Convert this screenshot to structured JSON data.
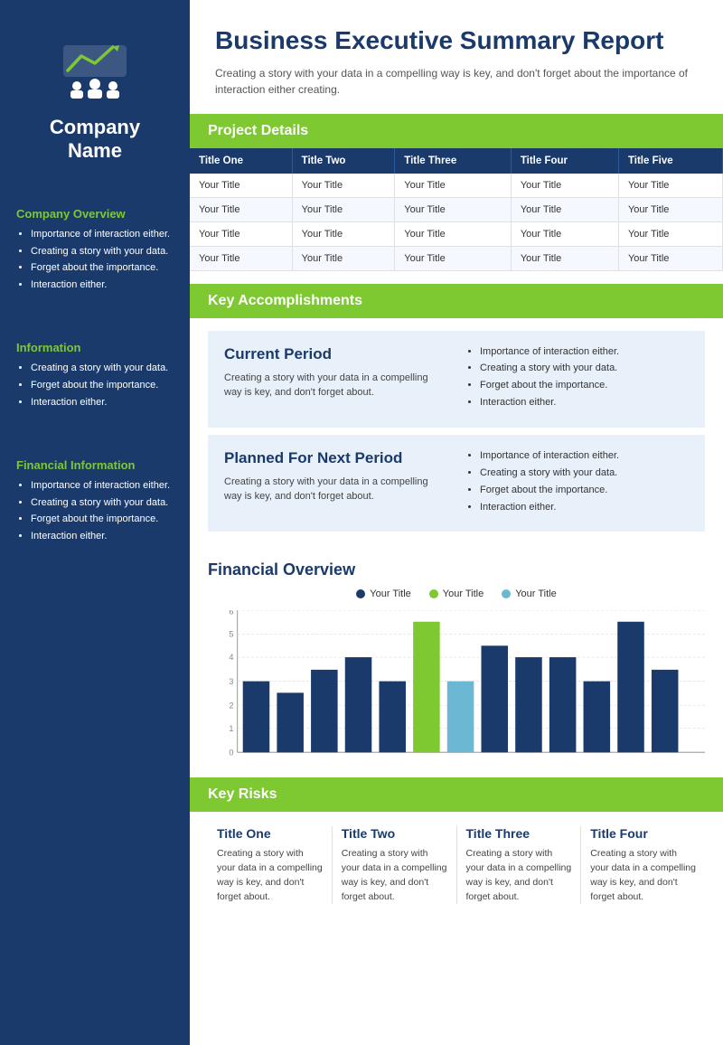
{
  "sidebar": {
    "company_name": "Company\nName",
    "sections": [
      {
        "id": "company-overview",
        "title": "Company Overview",
        "items": [
          "Importance of interaction either.",
          "Creating a story with your data.",
          "Forget about the importance.",
          "Interaction either."
        ]
      },
      {
        "id": "information",
        "title": "Information",
        "items": [
          "Creating a story with your data.",
          "Forget about the importance.",
          "Interaction either."
        ]
      },
      {
        "id": "financial-information",
        "title": "Financial Information",
        "items": [
          "Importance of interaction either.",
          "Creating a story with your data.",
          "Forget about the importance.",
          "Interaction either."
        ]
      }
    ]
  },
  "header": {
    "title": "Business Executive Summary Report",
    "subtitle": "Creating a story with your data in a compelling way is key, and don't forget about the importance of interaction either creating."
  },
  "project_details": {
    "heading": "Project Details",
    "columns": [
      "Title One",
      "Title Two",
      "Title Three",
      "Title Four",
      "Title Five"
    ],
    "rows": [
      [
        "Your Title",
        "Your Title",
        "Your Title",
        "Your Title",
        "Your Title"
      ],
      [
        "Your Title",
        "Your Title",
        "Your Title",
        "Your Title",
        "Your Title"
      ],
      [
        "Your Title",
        "Your Title",
        "Your Title",
        "Your Title",
        "Your Title"
      ],
      [
        "Your Title",
        "Your Title",
        "Your Title",
        "Your Title",
        "Your Title"
      ]
    ]
  },
  "key_accomplishments": {
    "heading": "Key Accomplishments",
    "boxes": [
      {
        "title": "Current Period",
        "text": "Creating a story with your data in a compelling way is key, and don't forget about.",
        "bullets": [
          "Importance of interaction either.",
          "Creating a story with your data.",
          "Forget about the importance.",
          "Interaction either."
        ]
      },
      {
        "title": "Planned For Next Period",
        "text": "Creating a story with your data in a compelling way is key, and don't forget about.",
        "bullets": [
          "Importance of interaction either.",
          "Creating a story with your data.",
          "Forget about the importance.",
          "Interaction either."
        ]
      }
    ]
  },
  "financial_overview": {
    "heading": "Financial Overview",
    "legend": [
      {
        "label": "Your Title",
        "color": "#1a3a6b"
      },
      {
        "label": "Your Title",
        "color": "#7ec832"
      },
      {
        "label": "Your Title",
        "color": "#6ab8d4"
      }
    ],
    "y_labels": [
      "0",
      "1",
      "2",
      "3",
      "4",
      "5",
      "6"
    ],
    "bars": [
      {
        "value": 3,
        "color": "#1a3a6b"
      },
      {
        "value": 2.5,
        "color": "#1a3a6b"
      },
      {
        "value": 3.5,
        "color": "#1a3a6b"
      },
      {
        "value": 4,
        "color": "#1a3a6b"
      },
      {
        "value": 3,
        "color": "#1a3a6b"
      },
      {
        "value": 5.5,
        "color": "#7ec832"
      },
      {
        "value": 3,
        "color": "#6ab8d4"
      },
      {
        "value": 4.5,
        "color": "#1a3a6b"
      },
      {
        "value": 4,
        "color": "#1a3a6b"
      },
      {
        "value": 4,
        "color": "#1a3a6b"
      },
      {
        "value": 3,
        "color": "#1a3a6b"
      },
      {
        "value": 5.5,
        "color": "#1a3a6b"
      },
      {
        "value": 3.5,
        "color": "#1a3a6b"
      }
    ],
    "max_value": 6
  },
  "key_risks": {
    "heading": "Key Risks",
    "items": [
      {
        "title": "Title One",
        "text": "Creating a story with your data in a compelling way is key, and don't forget about."
      },
      {
        "title": "Title Two",
        "text": "Creating a story with your data in a compelling way is key, and don't forget about."
      },
      {
        "title": "Title Three",
        "text": "Creating a story with your data in a compelling way is key, and don't forget about."
      },
      {
        "title": "Title Four",
        "text": "Creating a story with your data in a compelling way is key, and don't forget about."
      }
    ]
  },
  "colors": {
    "sidebar_bg": "#1a3a6b",
    "accent_green": "#7ec832",
    "accent_blue": "#6ab8d4",
    "dark_blue": "#1a3a6b"
  }
}
